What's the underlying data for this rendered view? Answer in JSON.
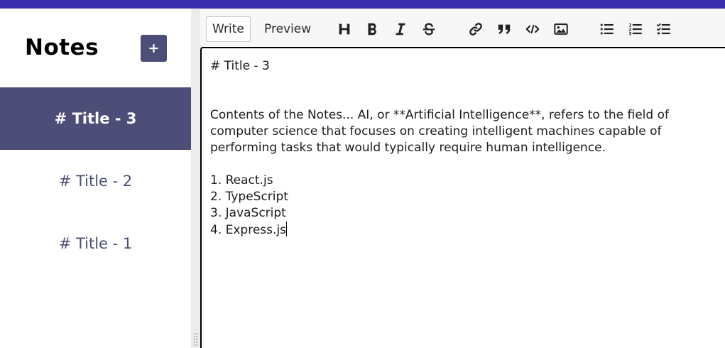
{
  "sidebar": {
    "title": "Notes",
    "add_label": "+",
    "notes": [
      {
        "label": "# Title - 3",
        "active": true
      },
      {
        "label": "# Title - 2",
        "active": false
      },
      {
        "label": "# Title - 1",
        "active": false
      }
    ]
  },
  "toolbar": {
    "write_label": "Write",
    "preview_label": "Preview",
    "tools": [
      "header-icon",
      "bold-icon",
      "italic-icon",
      "strikethrough-icon",
      "link-icon",
      "quote-icon",
      "code-icon",
      "image-icon",
      "unordered-list-icon",
      "ordered-list-icon",
      "checklist-icon"
    ]
  },
  "editor": {
    "lines": [
      "# Title - 3",
      "",
      "",
      "Contents of the Notes... AI, or **Artificial Intelligence**, refers to the field of",
      "computer science that focuses on creating intelligent machines capable of",
      "performing tasks that would typically require human intelligence.",
      "",
      "1. React.js",
      "2. TypeScript",
      "3. JavaScript",
      "4. Express.js"
    ]
  },
  "colors": {
    "topbar": "#3b2dab",
    "accent": "#4c4e78"
  }
}
